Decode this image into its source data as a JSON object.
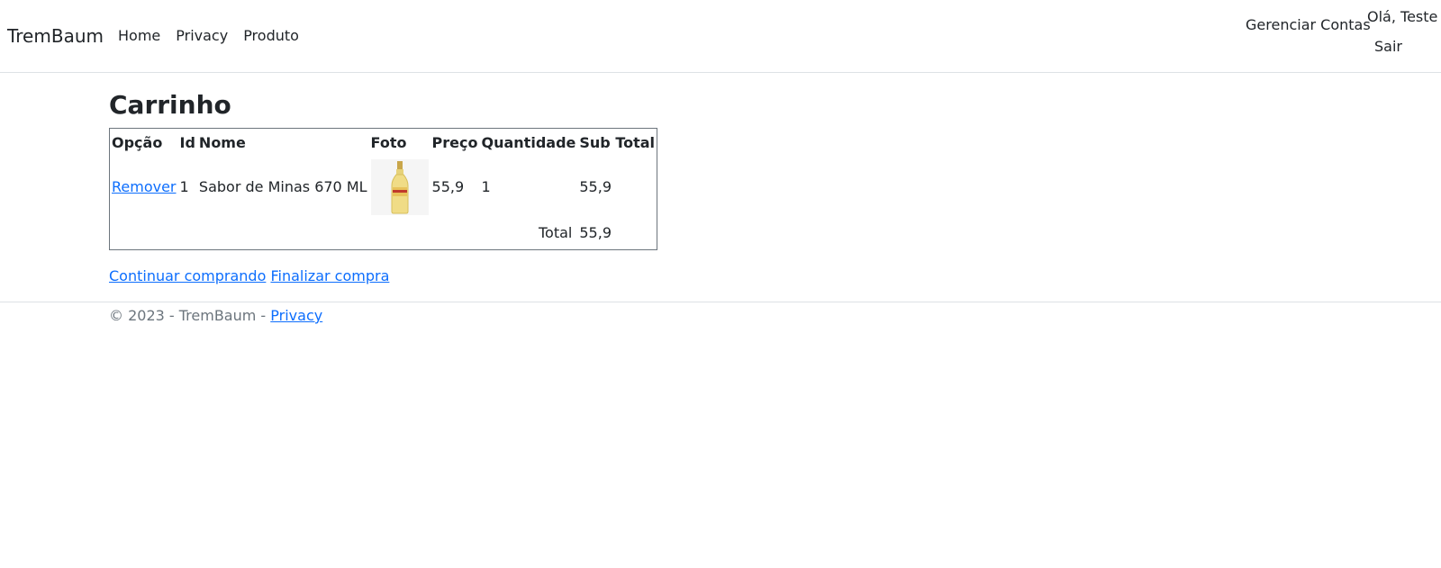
{
  "navbar": {
    "brand": "TremBaum",
    "links": [
      "Home",
      "Privacy",
      "Produto"
    ],
    "manage_accounts": "Gerenciar Contas",
    "greeting": "Olá, Teste",
    "logout": "Sair"
  },
  "main": {
    "title": "Carrinho",
    "table": {
      "headers": [
        "Opção",
        "Id",
        "Nome",
        "Foto",
        "Preço",
        "Quantidade",
        "Sub Total"
      ],
      "rows": [
        {
          "option": "Remover",
          "id": "1",
          "name": "Sabor de Minas 670 ML",
          "photo_icon": "bottle-icon",
          "price": "55,9",
          "quantity": "1",
          "subtotal": "55,9"
        }
      ],
      "total_label": "Total",
      "total_value": "55,9"
    },
    "continue_shopping": "Continuar comprando",
    "checkout": "Finalizar compra"
  },
  "footer": {
    "copyright": "© 2023 - TremBaum - ",
    "privacy_link": "Privacy"
  },
  "colors": {
    "link": "#0d6efd",
    "muted": "#6c757d",
    "text": "#212529",
    "border": "#dee2e6"
  }
}
